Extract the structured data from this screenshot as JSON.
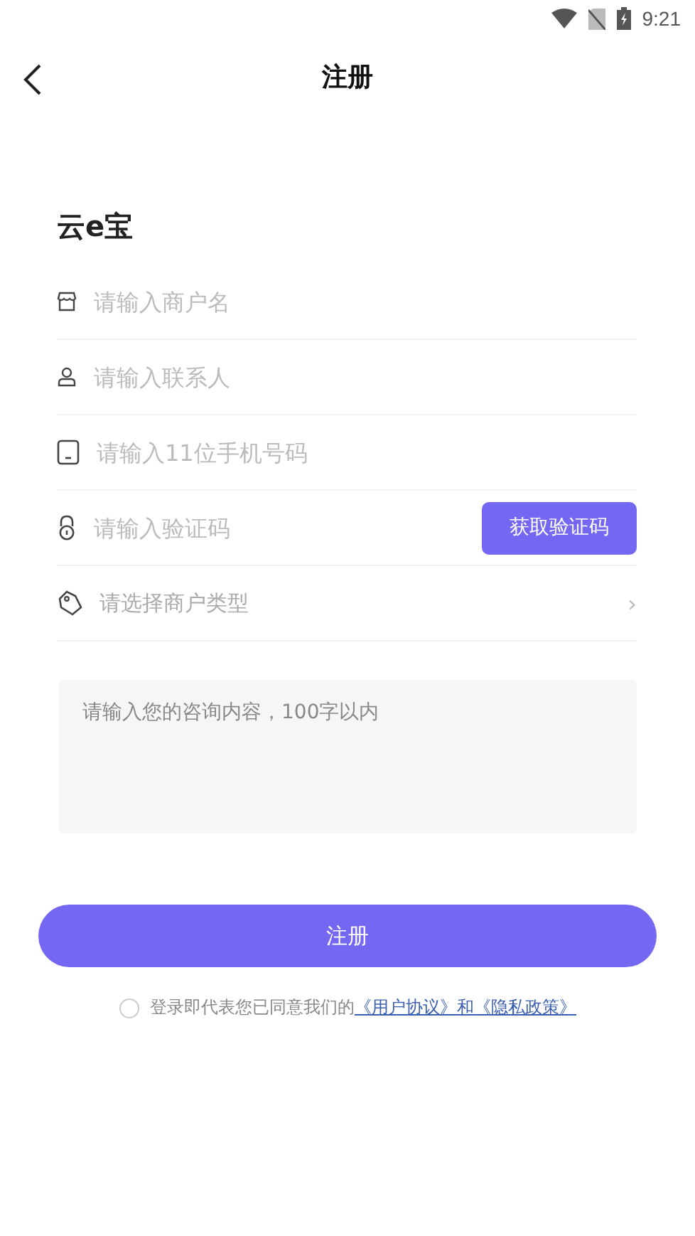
{
  "status_bar": {
    "time": "9:21"
  },
  "header": {
    "title": "注册"
  },
  "brand": "云e宝",
  "fields": [
    {
      "kind": "text",
      "placeholder": "请输入商户名"
    },
    {
      "kind": "text",
      "placeholder": "请输入联系人"
    },
    {
      "kind": "text",
      "placeholder": "请输入11位手机号码"
    },
    {
      "kind": "code",
      "placeholder": "请输入验证码",
      "button": "获取验证码"
    },
    {
      "kind": "select",
      "placeholder": "请选择商户类型",
      "chevron": "›"
    }
  ],
  "message": {
    "placeholder": "请输入您的咨询内容，100字以内"
  },
  "submit": "注册",
  "agreement": {
    "checked": false,
    "text": "登录即代表您已同意我们的",
    "link_1": "《用户协议》",
    "joiner": "和",
    "link_2": "《隐私政策》"
  }
}
